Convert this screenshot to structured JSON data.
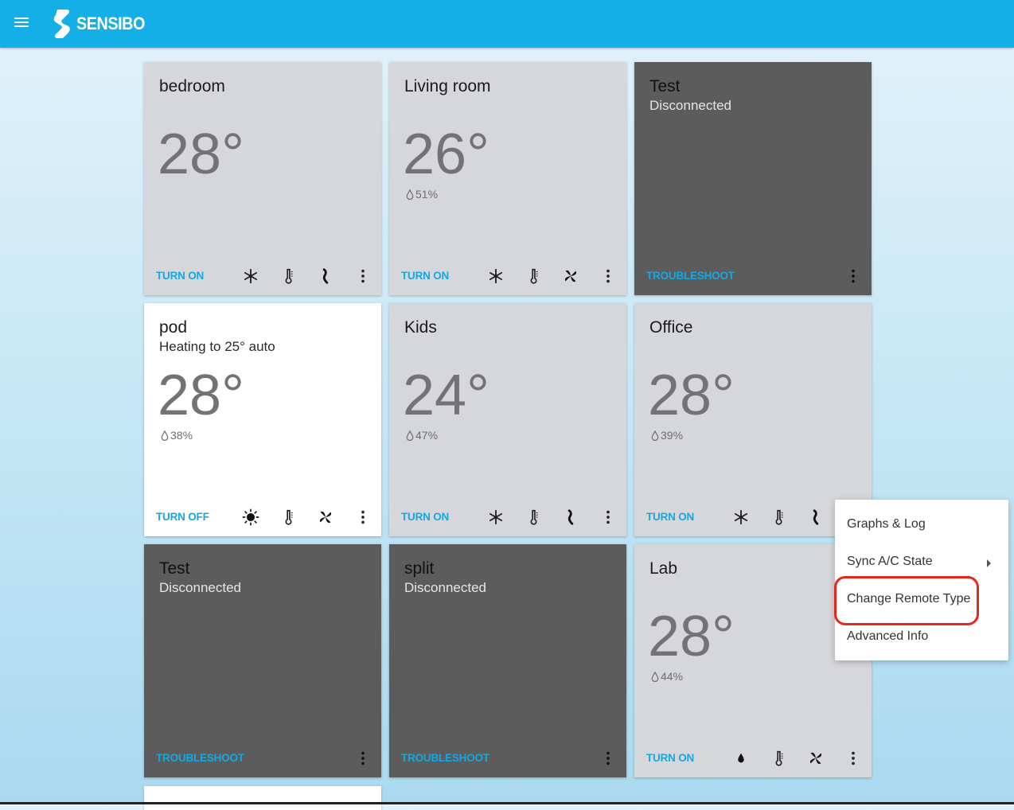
{
  "app": {
    "brand": "SENSIBO",
    "accent": "#14afe6"
  },
  "cards": [
    {
      "name": "bedroom",
      "status": "",
      "temperature": "28°",
      "humidity": "",
      "action": "TURN ON",
      "state": "off",
      "mode": "cool"
    },
    {
      "name": "Living room",
      "status": "",
      "temperature": "26°",
      "humidity": "51%",
      "action": "TURN ON",
      "state": "off",
      "mode": "cool"
    },
    {
      "name": "Test",
      "status": "Disconnected",
      "temperature": "",
      "humidity": "",
      "action": "TROUBLESHOOT",
      "state": "disconnected"
    },
    {
      "name": "pod",
      "status": "Heating to 25° auto",
      "temperature": "28°",
      "humidity": "38%",
      "action": "TURN OFF",
      "state": "on",
      "mode": "heat"
    },
    {
      "name": "Kids",
      "status": "",
      "temperature": "24°",
      "humidity": "47%",
      "action": "TURN ON",
      "state": "off",
      "mode": "cool"
    },
    {
      "name": "Office",
      "status": "",
      "temperature": "28°",
      "humidity": "39%",
      "action": "TURN ON",
      "state": "off",
      "mode": "cool"
    },
    {
      "name": "Test",
      "status": "Disconnected",
      "temperature": "",
      "humidity": "",
      "action": "TROUBLESHOOT",
      "state": "disconnected"
    },
    {
      "name": "split",
      "status": "Disconnected",
      "temperature": "",
      "humidity": "",
      "action": "TROUBLESHOOT",
      "state": "disconnected"
    },
    {
      "name": "Lab",
      "status": "",
      "temperature": "28°",
      "humidity": "44%",
      "action": "TURN ON",
      "state": "off",
      "mode": "dry"
    }
  ],
  "menu": {
    "items": [
      "Graphs & Log",
      "Sync A/C State",
      "Change Remote Type",
      "Advanced Info"
    ]
  },
  "icons": {
    "mode_cool": "snowflake-icon",
    "mode_heat": "sun-icon",
    "mode_dry": "droplet-icon",
    "temperature": "thermometer-icon",
    "fan": "fan-icon",
    "swing": "swing-icon",
    "more": "more-vert-icon"
  },
  "colors": {
    "action_text": "#17a7e0",
    "disconnected_card": "#5c5c5c",
    "idle_card": "#d6d7db",
    "active_card": "#ffffff",
    "highlight": "#e3281c"
  }
}
